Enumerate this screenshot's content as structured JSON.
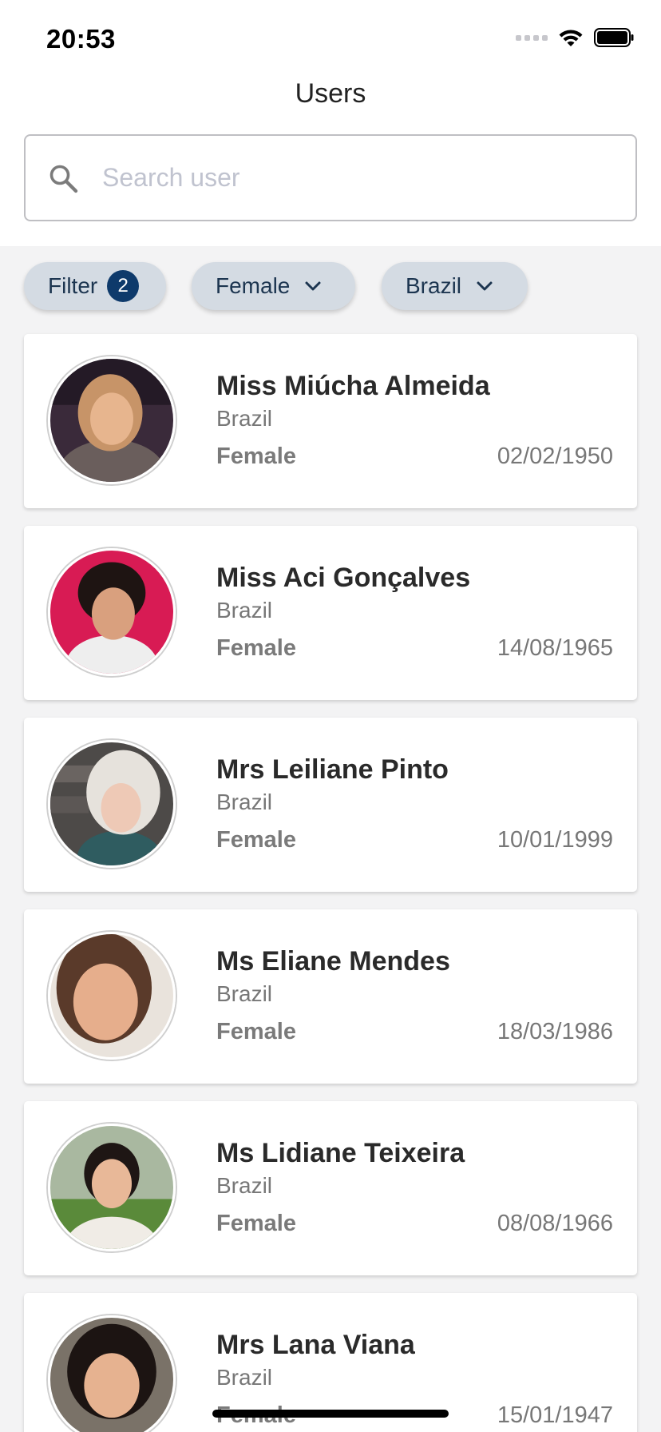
{
  "status": {
    "time": "20:53"
  },
  "header": {
    "title": "Users"
  },
  "search": {
    "placeholder": "Search user",
    "value": ""
  },
  "filters": {
    "filter_label": "Filter",
    "filter_count": "2",
    "gender_label": "Female",
    "country_label": "Brazil"
  },
  "users": [
    {
      "name": "Miss Miúcha Almeida",
      "country": "Brazil",
      "gender": "Female",
      "dob": "02/02/1950"
    },
    {
      "name": "Miss Aci Gonçalves",
      "country": "Brazil",
      "gender": "Female",
      "dob": "14/08/1965"
    },
    {
      "name": "Mrs Leiliane Pinto",
      "country": "Brazil",
      "gender": "Female",
      "dob": "10/01/1999"
    },
    {
      "name": "Ms Eliane Mendes",
      "country": "Brazil",
      "gender": "Female",
      "dob": "18/03/1986"
    },
    {
      "name": "Ms Lidiane Teixeira",
      "country": "Brazil",
      "gender": "Female",
      "dob": "08/08/1966"
    },
    {
      "name": "Mrs Lana Viana",
      "country": "Brazil",
      "gender": "Female",
      "dob": "15/01/1947"
    }
  ],
  "colors": {
    "chip_bg": "#d4dbe3",
    "chip_text": "#1c3550",
    "badge_bg": "#0e3a6b",
    "page_bg": "#f3f3f4"
  }
}
